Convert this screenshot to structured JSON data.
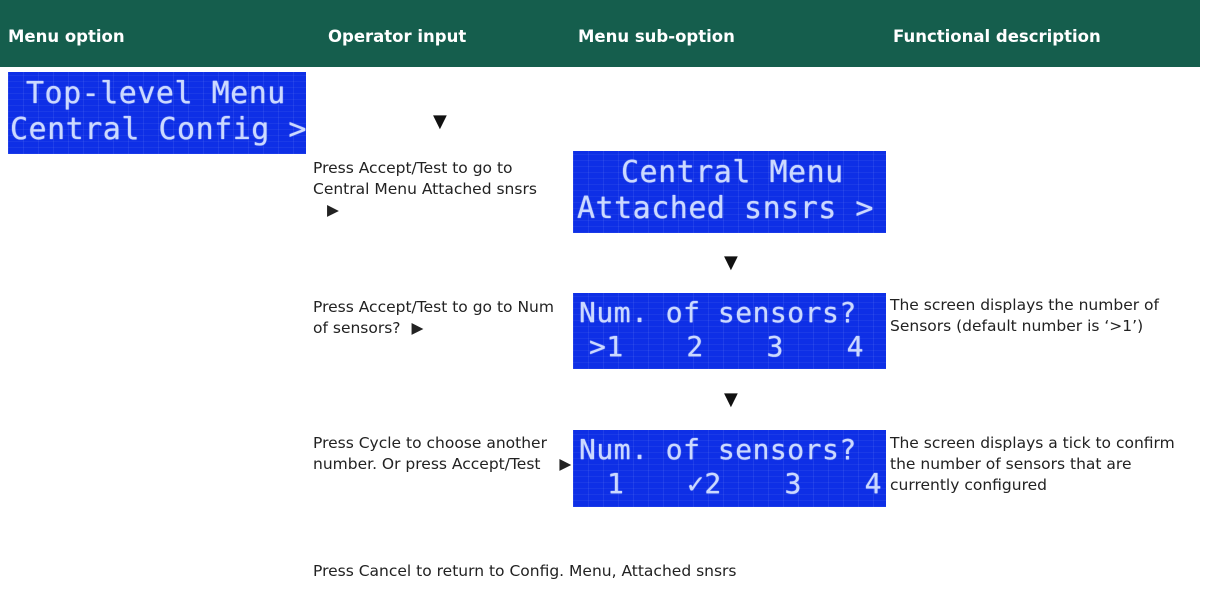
{
  "header": {
    "col_menu_option": "Menu option",
    "col_operator_input": "Operator input",
    "col_menu_sub_option": "Menu sub-option",
    "col_functional_description": "Functional description"
  },
  "top_lcd": {
    "line1": "Top-level Menu",
    "line2": "Central Config >"
  },
  "steps": [
    {
      "operator_input": "Press Accept/Test to go to Central Menu Attached snsrs",
      "lcd_line1": "Central Menu",
      "lcd_line2": "Attached snsrs >",
      "description": ""
    },
    {
      "operator_input": "Press Accept/Test to go to Num of sensors?",
      "lcd_line1": "Num. of sensors?",
      "lcd_line2": ">1  2  3  4",
      "description": "The screen displays the number of Sensors (default number is ‘>1’)"
    },
    {
      "operator_input": "Press Cycle to choose another number. Or press Accept/Test",
      "lcd_line1": "Num. of sensors?",
      "lcd_line2": "1  ✓2  3  4",
      "description": "The screen displays a tick to confirm the number of sensors that are currently configured"
    }
  ],
  "footer_note": "Press Cancel to return to Config. Menu, Attached snsrs",
  "icons": {
    "down_arrow": "▼",
    "right_arrow": "▶"
  },
  "colors": {
    "header_bg": "#155e4d",
    "lcd_bg": "#0e2fe6",
    "lcd_text": "#cbd9ff"
  }
}
